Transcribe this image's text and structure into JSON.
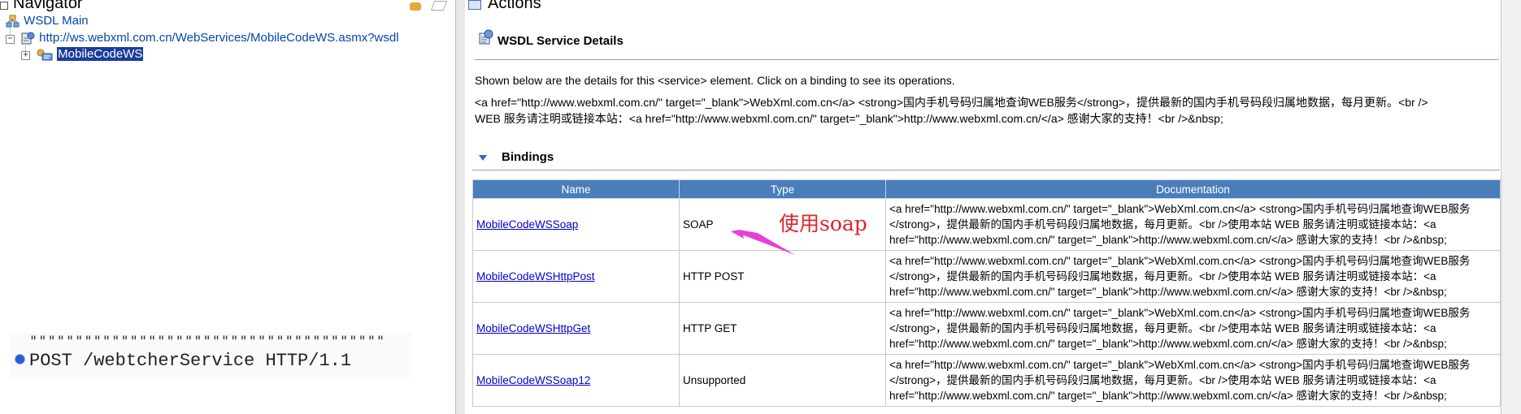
{
  "navigator": {
    "title": "Navigator",
    "tree": {
      "root_label": "WSDL Main",
      "wsdl_url": "http://ws.webxml.com.cn/WebServices/MobileCodeWS.asmx?wsdl",
      "service_label": "MobileCodeWS"
    }
  },
  "overlay_code": {
    "quotes": "\"\"\"\"\"\"\"\"\"\"\"\"\"\"\"\"\"\"\"\"\"\"\"\"\"\"\"\"\"\"\"\"\"\"\"\"\"\"\"",
    "line": "POST /webtcherService HTTP/1.1"
  },
  "actions": {
    "title": "Actions",
    "section_title": "WSDL Service Details",
    "description": "Shown below are the details for this <service> element. Click on a binding to see its operations.",
    "service_doc_line1": "<a href=\"http://www.webxml.com.cn/\" target=\"_blank\">WebXml.com.cn</a> <strong>国内手机号码归属地查询WEB服务</strong>，提供最新的国内手机号码段归属地数据，每月更新。<br />",
    "service_doc_line2": "WEB 服务请注明或链接本站：<a href=\"http://www.webxml.com.cn/\" target=\"_blank\">http://www.webxml.com.cn/</a> 感谢大家的支持！<br />&nbsp;",
    "bindings_title": "Bindings",
    "table_headers": [
      "Name",
      "Type",
      "Documentation"
    ],
    "rows": [
      {
        "name": "MobileCodeWSSoap",
        "type": "SOAP",
        "doc1": "<a href=\"http://www.webxml.com.cn/\" target=\"_blank\">WebXml.com.cn</a> <strong>国内手机号码归属地查询WEB服务",
        "doc2": "</strong>，提供最新的国内手机号码段归属地数据，每月更新。<br />使用本站 WEB 服务请注明或链接本站：<a",
        "doc3": "href=\"http://www.webxml.com.cn/\" target=\"_blank\">http://www.webxml.com.cn/</a> 感谢大家的支持！<br />&nbsp;"
      },
      {
        "name": "MobileCodeWSHttpPost",
        "type": "HTTP POST",
        "doc1": "<a href=\"http://www.webxml.com.cn/\" target=\"_blank\">WebXml.com.cn</a> <strong>国内手机号码归属地查询WEB服务",
        "doc2": "</strong>，提供最新的国内手机号码段归属地数据，每月更新。<br />使用本站 WEB 服务请注明或链接本站：<a",
        "doc3": "href=\"http://www.webxml.com.cn/\" target=\"_blank\">http://www.webxml.com.cn/</a> 感谢大家的支持！<br />&nbsp;"
      },
      {
        "name": "MobileCodeWSHttpGet",
        "type": "HTTP GET",
        "doc1": "<a href=\"http://www.webxml.com.cn/\" target=\"_blank\">WebXml.com.cn</a> <strong>国内手机号码归属地查询WEB服务",
        "doc2": "</strong>，提供最新的国内手机号码段归属地数据，每月更新。<br />使用本站 WEB 服务请注明或链接本站：<a",
        "doc3": "href=\"http://www.webxml.com.cn/\" target=\"_blank\">http://www.webxml.com.cn/</a> 感谢大家的支持！<br />&nbsp;"
      },
      {
        "name": "MobileCodeWSSoap12",
        "type": "Unsupported",
        "doc1": "<a href=\"http://www.webxml.com.cn/\" target=\"_blank\">WebXml.com.cn</a> <strong>国内手机号码归属地查询WEB服务",
        "doc2": "</strong>，提供最新的国内手机号码段归属地数据，每月更新。<br />使用本站 WEB 服务请注明或链接本站：<a",
        "doc3": "href=\"http://www.webxml.com.cn/\" target=\"_blank\">http://www.webxml.com.cn/</a> 感谢大家的支持！<br />&nbsp;"
      }
    ]
  },
  "annotation": {
    "text": "使用soap",
    "color": "#e0242a",
    "arrow_color": "#e83fd6"
  },
  "colors": {
    "table_header_bg": "#4a7ebb",
    "link": "#0000cc",
    "selection": "#1a3d9c"
  }
}
